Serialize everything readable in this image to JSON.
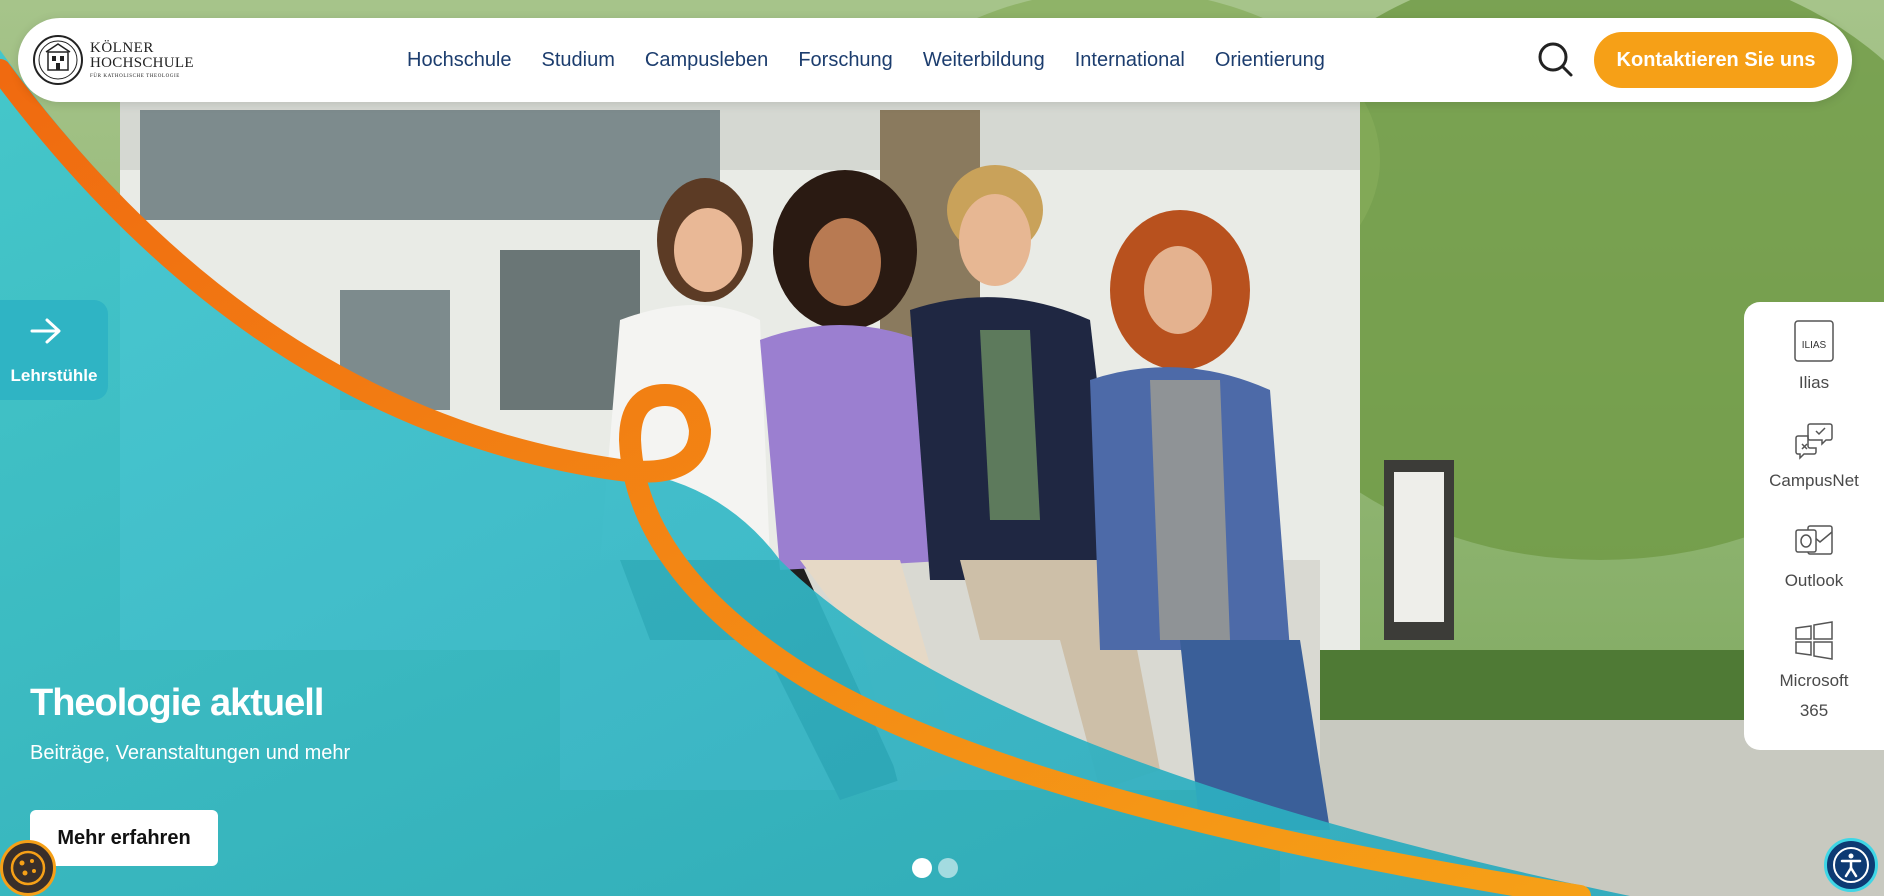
{
  "logo": {
    "line1": "KÖLNER",
    "line2": "HOCHSCHULE",
    "line3": "für katholische Theologie"
  },
  "nav": {
    "items": [
      "Hochschule",
      "Studium",
      "Campusleben",
      "Forschung",
      "Weiterbildung",
      "International",
      "Orientierung"
    ]
  },
  "header": {
    "cta_label": "Kontaktieren Sie uns"
  },
  "sidebar_left": {
    "label": "Lehrstühle"
  },
  "services": {
    "ilias_icon_text": "ILIAS",
    "ilias": "Ilias",
    "campusnet": "CampusNet",
    "outlook": "Outlook",
    "microsoft_line1": "Microsoft",
    "microsoft_line2": "365"
  },
  "hero": {
    "title": "Theologie aktuell",
    "subtitle": "Beiträge, Veranstaltungen und mehr",
    "button": "Mehr erfahren"
  },
  "slider": {
    "total": 2,
    "active": 1
  },
  "colors": {
    "accent_orange": "#f6a017",
    "teal": "#2fb4c4",
    "nav_text": "#1c3d6e",
    "a11y_blue": "#0d3a73"
  }
}
